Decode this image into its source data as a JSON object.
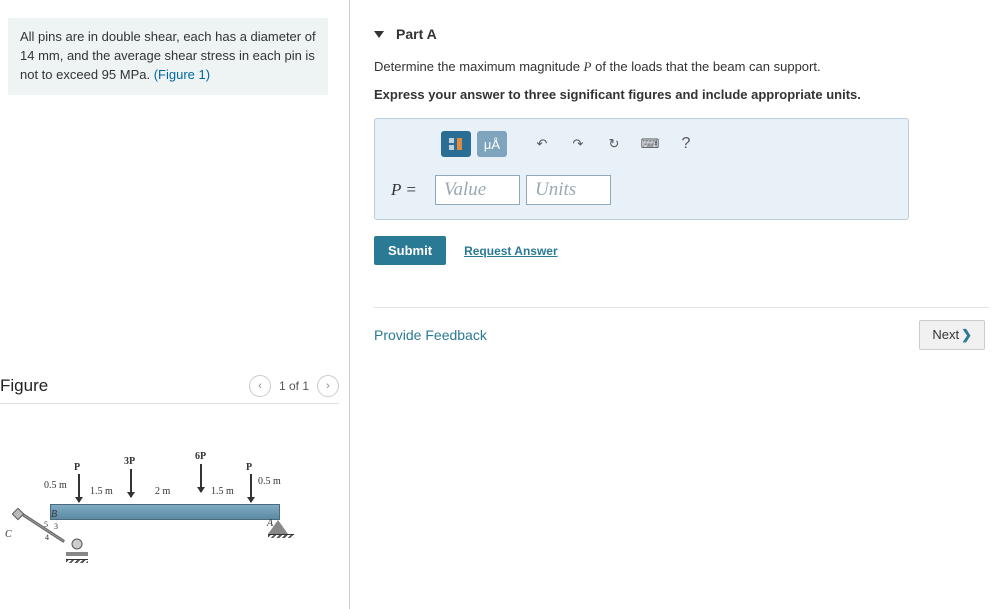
{
  "problem": {
    "text_before_link": "All pins are in double shear, each has a diameter of 14 mm, and the average shear stress in each pin is not to exceed 95 MPa. ",
    "link_text": "(Figure 1)"
  },
  "figure": {
    "title": "Figure",
    "page_indicator": "1 of 1",
    "labels": {
      "P_left": "P",
      "P3": "3P",
      "P6": "6P",
      "P_right": "P",
      "d05a": "0.5 m",
      "d15a": "1.5 m",
      "d2": "2 m",
      "d15b": "1.5 m",
      "d05b": "0.5 m",
      "B": "B",
      "A": "A",
      "C": "C",
      "ang5": "5",
      "ang3": "3",
      "ang4": "4"
    }
  },
  "part": {
    "label": "Part A",
    "question_pre": "Determine the maximum magnitude ",
    "question_var": "P",
    "question_post": " of the loads that the beam can support.",
    "instruction": "Express your answer to three significant figures and include appropriate units.",
    "eq_prefix": "P =",
    "value_placeholder": "Value",
    "units_placeholder": "Units",
    "toolbar": {
      "ua": "μÅ"
    },
    "submit_label": "Submit",
    "request_answer": "Request Answer"
  },
  "footer": {
    "feedback": "Provide Feedback",
    "next": "Next"
  }
}
